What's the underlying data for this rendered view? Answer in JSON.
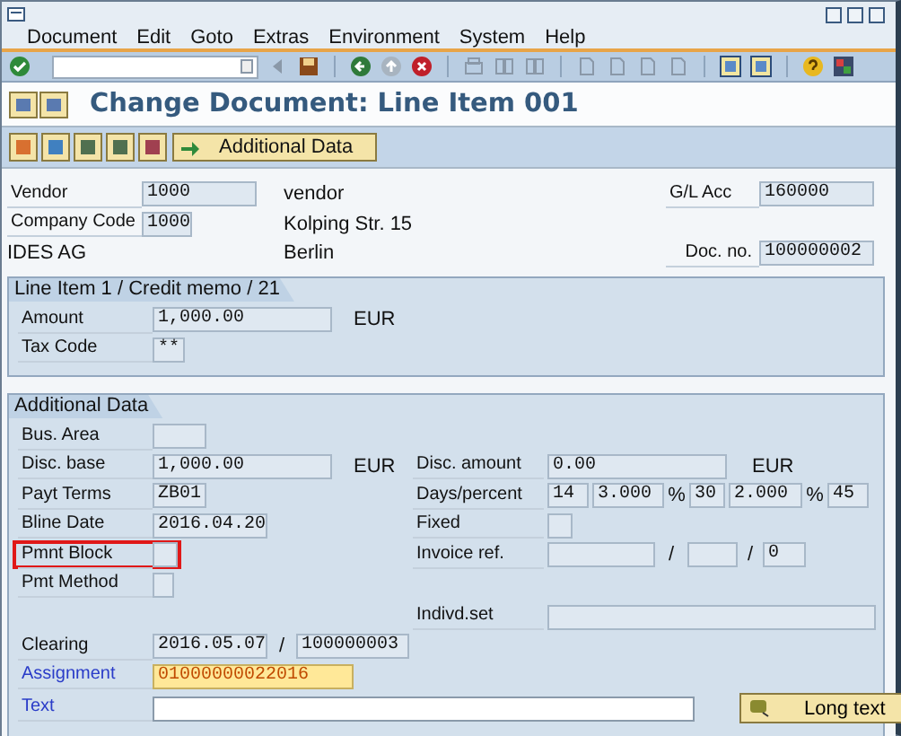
{
  "menu": [
    "Document",
    "Edit",
    "Goto",
    "Extras",
    "Environment",
    "System",
    "Help"
  ],
  "title": "Change Document: Line Item 001",
  "app_toolbar": {
    "button": "Additional Data"
  },
  "header": {
    "vendor": {
      "label": "Vendor",
      "value": "1000",
      "kind": "display"
    },
    "vendor_name": "vendor",
    "gl_account": {
      "label": "G/L Acc",
      "value": "160000",
      "kind": "display"
    },
    "company_code": {
      "label": "Company Code",
      "value": "1000",
      "kind": "display"
    },
    "street": "Kolping Str. 15",
    "company_name": "IDES AG",
    "city": "Berlin",
    "doc_no": {
      "label": "Doc. no.",
      "value": "100000002",
      "kind": "display"
    }
  },
  "line_item": {
    "title": "Line Item 1 / Credit memo / 21",
    "amount": {
      "label": "Amount",
      "value": "1,000.00",
      "currency": "EUR",
      "kind": "display"
    },
    "tax_code": {
      "label": "Tax Code",
      "value": "**",
      "kind": "display"
    }
  },
  "additional": {
    "title": "Additional Data",
    "bus_area": {
      "label": "Bus. Area",
      "kind": "display"
    },
    "disc_base": {
      "label": "Disc. base",
      "value": "1,000.00",
      "currency": "EUR",
      "kind": "display"
    },
    "disc_amount": {
      "label": "Disc. amount",
      "value": "0.00",
      "currency": "EUR",
      "kind": "display"
    },
    "payt_terms": {
      "label": "Payt Terms",
      "value": "ZB01",
      "kind": "display"
    },
    "days_percent": {
      "label": "Days/percent",
      "parts": [
        {
          "kind": "field",
          "value": "14"
        },
        {
          "kind": "field",
          "value": "3.000"
        },
        {
          "kind": "separator",
          "text": "%"
        },
        {
          "kind": "field",
          "value": "30"
        },
        {
          "kind": "field",
          "value": "2.000"
        },
        {
          "kind": "separator",
          "text": "%"
        },
        {
          "kind": "field",
          "value": "45"
        }
      ]
    },
    "bline_date": {
      "label": "Bline Date",
      "value": "2016.04.20",
      "kind": "display"
    },
    "fixed": {
      "label": "Fixed",
      "kind": "display"
    },
    "pmnt_block": {
      "label": "Pmnt Block",
      "kind": "display",
      "marked": true
    },
    "invoice_ref": {
      "label": "Invoice ref.",
      "parts": [
        {
          "kind": "field"
        },
        {
          "kind": "separator",
          "text": "/"
        },
        {
          "kind": "field"
        },
        {
          "kind": "separator",
          "text": "/"
        },
        {
          "kind": "field",
          "value": "0"
        }
      ]
    },
    "pmt_method": {
      "label": "Pmt Method",
      "kind": "display"
    },
    "indivd_set": {
      "label": "Indivd.set",
      "kind": "display"
    },
    "clearing": {
      "label": "Clearing",
      "parts": [
        {
          "kind": "field",
          "value": "2016.05.07"
        },
        {
          "kind": "separator",
          "text": "/"
        },
        {
          "kind": "field",
          "value": "100000003"
        }
      ]
    },
    "assignment": {
      "label": "Assignment",
      "value": "01000000022016",
      "kind": "highlight",
      "label_link": true
    },
    "text": {
      "label": "Text",
      "kind": "input",
      "label_link": true
    },
    "long_text_button": "Long text"
  }
}
